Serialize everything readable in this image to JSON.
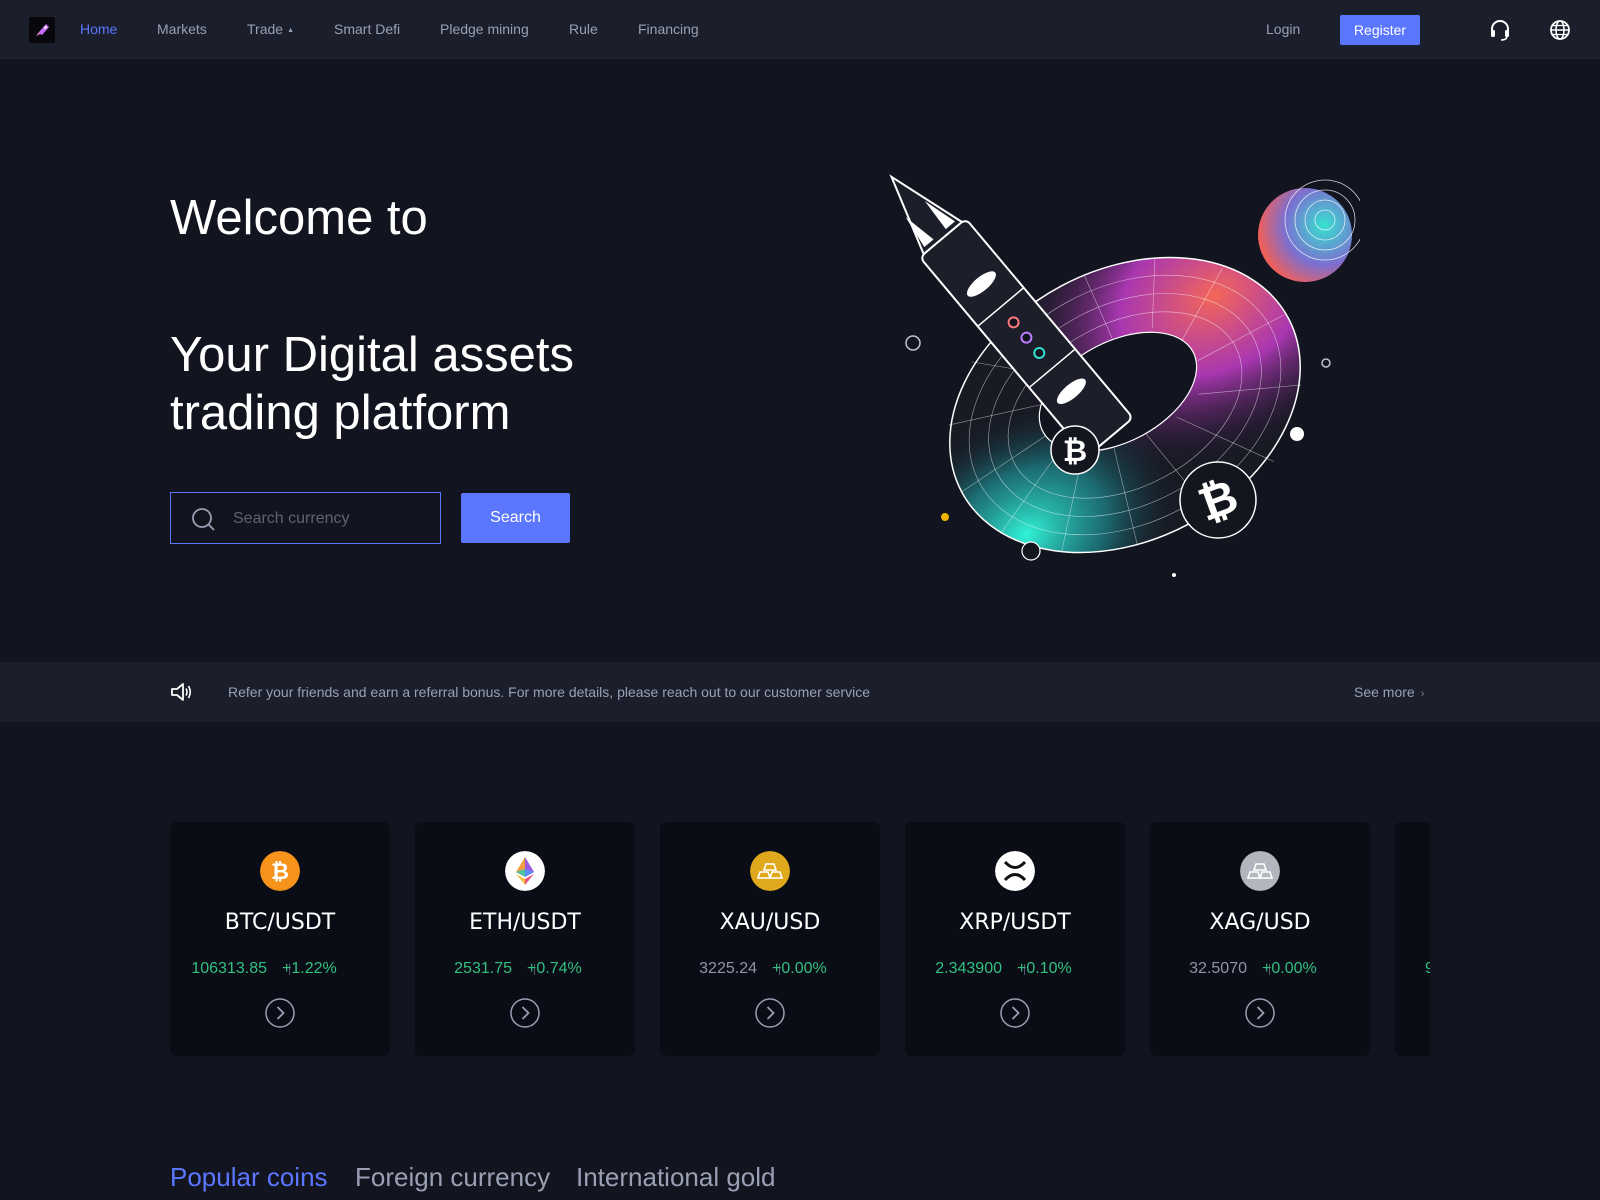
{
  "nav": {
    "items": [
      {
        "label": "Home",
        "active": true
      },
      {
        "label": "Markets",
        "active": false
      },
      {
        "label": "Trade",
        "active": false
      },
      {
        "label": "Smart Defi",
        "active": false
      },
      {
        "label": "Pledge mining",
        "active": false
      },
      {
        "label": "Rule",
        "active": false
      },
      {
        "label": "Financing",
        "active": false
      }
    ],
    "login": "Login",
    "register": "Register",
    "icons": [
      "headset-icon",
      "globe-icon"
    ]
  },
  "hero": {
    "line1": "Welcome to",
    "line2": "Your Digital assets",
    "line3": "trading platform",
    "search_placeholder": "Search currency",
    "search_button": "Search"
  },
  "notice": {
    "text": "Refer your friends and earn a referral bonus. For more details, please reach out to our customer service",
    "see_more": "See more"
  },
  "markets": [
    {
      "pair": "BTC/USDT",
      "price": "106313.85",
      "change": "+1.22%",
      "trend": "up",
      "icon": "btc-icon",
      "color": "#f7931a"
    },
    {
      "pair": "ETH/USDT",
      "price": "2531.75",
      "change": "+0.74%",
      "trend": "up",
      "icon": "eth-icon",
      "color": "#ffffff"
    },
    {
      "pair": "XAU/USD",
      "price": "3225.24",
      "change": "+0.00%",
      "trend": "flat",
      "icon": "gold-icon",
      "color": "#e0a81c"
    },
    {
      "pair": "XRP/USDT",
      "price": "2.343900",
      "change": "+0.10%",
      "trend": "up",
      "icon": "xrp-icon",
      "color": "#ffffff"
    },
    {
      "pair": "XAG/USD",
      "price": "32.5070",
      "change": "+0.00%",
      "trend": "flat",
      "icon": "silver-icon",
      "color": "#b3b6bf"
    },
    {
      "pair": "",
      "price": "9",
      "change": "",
      "trend": "up",
      "icon": "coin-icon",
      "color": "#32c081"
    }
  ],
  "tabs": [
    {
      "label": "Popular coins",
      "active": true
    },
    {
      "label": "Foreign currency",
      "active": false
    },
    {
      "label": "International gold",
      "active": false
    }
  ]
}
